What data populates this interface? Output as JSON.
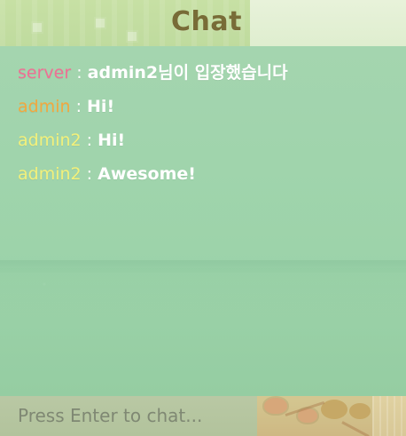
{
  "chat": {
    "title": "Chat",
    "messages": [
      {
        "sender": "server",
        "separator": " : ",
        "text": "admin2님이 입장했습니다"
      },
      {
        "sender": "admin",
        "separator": " : ",
        "text": "Hi!"
      },
      {
        "sender": "admin2",
        "separator": " : ",
        "text": "Hi!"
      },
      {
        "sender": "admin2",
        "separator": " : ",
        "text": "Awesome!"
      }
    ],
    "input": {
      "placeholder": "Press Enter to chat...",
      "value": ""
    }
  },
  "colors": {
    "title": "#786c37",
    "server": "#ef6f94",
    "admin": "#f2a83f",
    "admin2": "#f2f07b",
    "message_text": "#ffffff",
    "panel": "#9fd4ad",
    "input_bg": "#b7c8a2",
    "input_placeholder": "#7f8873"
  }
}
